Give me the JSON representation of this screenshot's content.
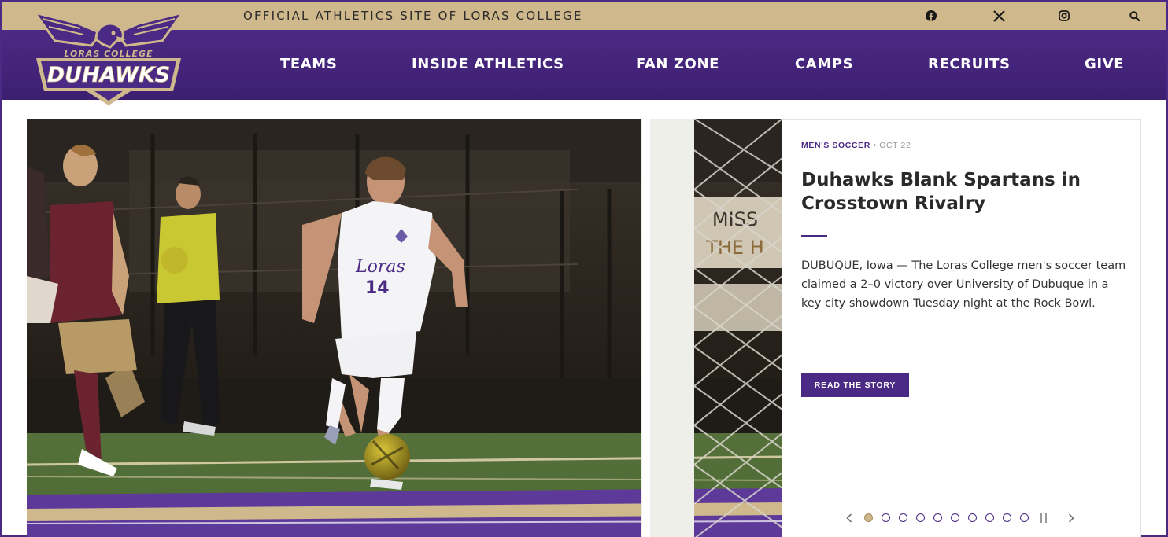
{
  "topbar": {
    "tagline": "OFFICIAL ATHLETICS SITE OF LORAS COLLEGE",
    "icons": [
      "facebook-icon",
      "x-icon",
      "instagram-icon",
      "search-icon"
    ]
  },
  "logo": {
    "line1": "LORAS COLLEGE",
    "line2": "DUHAWKS"
  },
  "nav": {
    "items": [
      "TEAMS",
      "INSIDE ATHLETICS",
      "FAN ZONE",
      "CAMPS",
      "RECRUITS",
      "GIVE"
    ]
  },
  "story": {
    "sport": "MEN'S SOCCER",
    "separator": "•",
    "date": "OCT 22",
    "headline": "Duhawks Blank Spartans in Crosstown Rivalry",
    "summary": "DUBUQUE, Iowa — The Loras College men's soccer team claimed a 2–0 victory over University of Dubuque in a key city showdown Tuesday night at the Rock Bowl.",
    "button": "READ THE STORY"
  },
  "photo": {
    "jersey_text": "Loras",
    "jersey_number": "14"
  },
  "carousel": {
    "slide_count": 10,
    "active_slide": 1
  },
  "colors": {
    "purple": "#4b2a85",
    "gold": "#cfb88c",
    "white": "#ffffff"
  }
}
